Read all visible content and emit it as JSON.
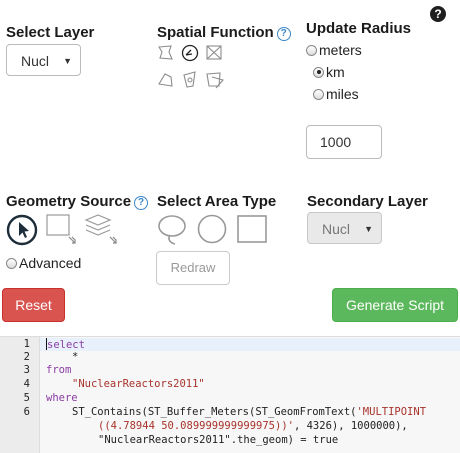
{
  "help_top": "?",
  "select_layer": {
    "label": "Select Layer",
    "value": "Nucl"
  },
  "spatial_function": {
    "label": "Spatial Function",
    "help": "?"
  },
  "update_radius": {
    "label": "Update Radius",
    "options": [
      "meters",
      "km",
      "miles"
    ],
    "selected": "km",
    "value": "1000"
  },
  "geometry_source": {
    "label": "Geometry Source",
    "help": "?",
    "advanced_label": "Advanced"
  },
  "select_area_type": {
    "label": "Select Area Type",
    "redraw_label": "Redraw"
  },
  "secondary_layer": {
    "label": "Secondary Layer",
    "value": "Nucl"
  },
  "buttons": {
    "reset": "Reset",
    "generate": "Generate Script"
  },
  "colors": {
    "reset": "#d9534f",
    "generate": "#5cb85c",
    "help": "#3a87c8"
  },
  "code": {
    "line_numbers": [
      "1",
      "2",
      "3",
      "4",
      "5",
      "6"
    ],
    "l1": "select",
    "l2": "*",
    "l3": "from",
    "l4": "\"NuclearReactors2011\"",
    "l5": "where",
    "l6a": "ST_Contains(ST_Buffer_Meters(ST_GeomFromText(",
    "l6b": "'MULTIPOINT",
    "l6c": "((4.78944 50.089999999999975))'",
    "l6d": ", 4326), 1000000),",
    "l6e": "\"NuclearReactors2011\".the_geom) = true"
  }
}
